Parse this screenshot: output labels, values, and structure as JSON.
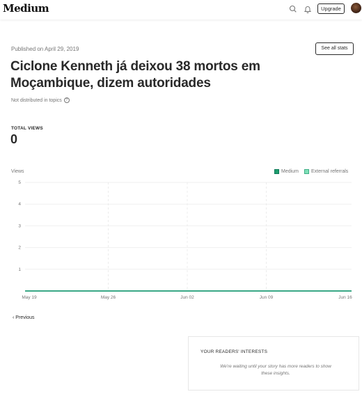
{
  "header": {
    "logo": "Medium",
    "upgrade_label": "Upgrade",
    "icons": [
      "search-icon",
      "bell-icon"
    ]
  },
  "story": {
    "published": "Published on April 29, 2019",
    "see_all_stats": "See all stats",
    "title": "Ciclone Kenneth já deixou 38 mortos em Moçambique, dizem autoridades",
    "distribution": "Not distributed in topics"
  },
  "total_views": {
    "label": "TOTAL VIEWS",
    "value": "0"
  },
  "chart_data": {
    "type": "area",
    "title": "",
    "ylabel": "Views",
    "xlabel": "",
    "ylim": [
      0,
      5
    ],
    "yticks": [
      "1",
      "2",
      "3",
      "4",
      "5"
    ],
    "x_tick_labels": [
      "May 19",
      "May 26",
      "Jun 02",
      "Jun 09",
      "Jun 16"
    ],
    "legend_position": "top-right",
    "grid": true,
    "series": [
      {
        "name": "Medium",
        "color": "#1a8917",
        "values": [
          0,
          0,
          0,
          0,
          0
        ]
      },
      {
        "name": "External referrals",
        "color": "#6fcfab",
        "values": [
          0,
          0,
          0,
          0,
          0
        ]
      }
    ]
  },
  "nav": {
    "previous": "Previous"
  },
  "interests": {
    "title": "YOUR READERS' INTERESTS",
    "message": "We're waiting until your story has more readers to show these insights."
  }
}
